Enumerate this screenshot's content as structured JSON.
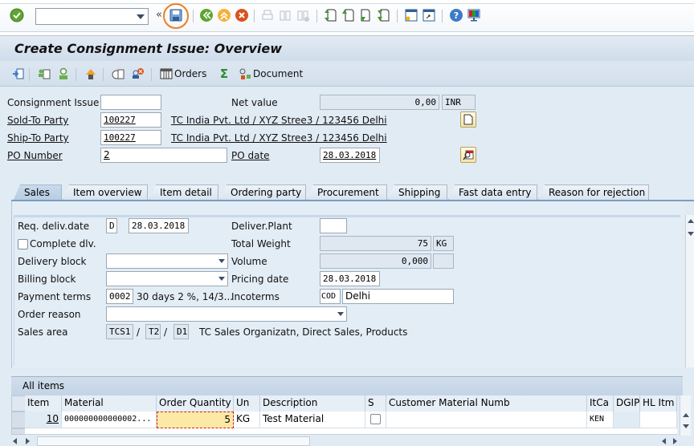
{
  "system_toolbar": {
    "command_field_value": "",
    "icons": [
      "enter-icon",
      "save-icon",
      "back-icon",
      "exit-icon",
      "cancel-icon",
      "print-icon",
      "find-icon",
      "find-next-icon",
      "first-page-icon",
      "previous-page-icon",
      "next-page-icon",
      "last-page-icon",
      "new-session-icon",
      "shortcut-icon",
      "help-icon",
      "customize-layout-icon"
    ],
    "highlighted_icon": "save-icon",
    "highlight_color": "#f07d1e"
  },
  "title": "Create Consignment Issue: Overview",
  "app_toolbar": {
    "orders_label": "Orders",
    "document_label": "Document"
  },
  "header": {
    "consignment_issue": {
      "label": "Consignment Issue",
      "value": ""
    },
    "net_value": {
      "label": "Net value",
      "value": "0,00",
      "currency": "INR"
    },
    "sold_to": {
      "label": "Sold-To Party",
      "value": "100227",
      "description": "TC India Pvt. Ltd / XYZ Stree3 / 123456 Delhi"
    },
    "ship_to": {
      "label": "Ship-To Party",
      "value": "100227",
      "description": "TC India Pvt. Ltd / XYZ Stree3 / 123456 Delhi"
    },
    "po_number": {
      "label": "PO Number",
      "value": "2"
    },
    "po_date": {
      "label": "PO date",
      "value": "28.03.2018"
    }
  },
  "tabs": [
    {
      "label": "Sales",
      "active": true
    },
    {
      "label": "Item overview",
      "active": false
    },
    {
      "label": "Item detail",
      "active": false
    },
    {
      "label": "Ordering party",
      "active": false
    },
    {
      "label": "Procurement",
      "active": false
    },
    {
      "label": "Shipping",
      "active": false
    },
    {
      "label": "Fast data entry",
      "active": false
    },
    {
      "label": "Reason for rejection",
      "active": false
    }
  ],
  "sales": {
    "req_deliv_date": {
      "label": "Req. deliv.date",
      "period": "D",
      "value": "28.03.2018"
    },
    "deliver_plant": {
      "label": "Deliver.Plant",
      "value": ""
    },
    "complete_dlv": {
      "label": "Complete dlv.",
      "checked": false
    },
    "total_weight": {
      "label": "Total Weight",
      "value": "75",
      "unit": "KG"
    },
    "delivery_block": {
      "label": "Delivery block",
      "value": ""
    },
    "volume": {
      "label": "Volume",
      "value": "0,000",
      "unit": ""
    },
    "billing_block": {
      "label": "Billing block",
      "value": ""
    },
    "pricing_date": {
      "label": "Pricing date",
      "value": "28.03.2018"
    },
    "payment_terms": {
      "label": "Payment terms",
      "value": "0002",
      "description": "30 days 2 %, 14/3..."
    },
    "incoterms": {
      "label": "Incoterms",
      "code": "COD",
      "location": "Delhi"
    },
    "order_reason": {
      "label": "Order reason",
      "value": ""
    },
    "sales_area": {
      "label": "Sales area",
      "org": "TCS1",
      "channel": "T2",
      "division": "D1",
      "separator": "/",
      "description": "TC Sales Organizatn, Direct Sales, Products"
    }
  },
  "items_table": {
    "title": "All items",
    "columns": [
      "Item",
      "Material",
      "Order Quantity",
      "Un",
      "Description",
      "S",
      "Customer Material Numb",
      "ItCa",
      "DGIP",
      "HL Itm"
    ],
    "rows": [
      {
        "item": "10",
        "material": "000000000000002...",
        "order_quantity": "5",
        "unit": "KG",
        "description": "Test Material",
        "s": false,
        "customer_material": "",
        "itca": "KEN",
        "dgip": "",
        "hl_itm": ""
      }
    ]
  }
}
